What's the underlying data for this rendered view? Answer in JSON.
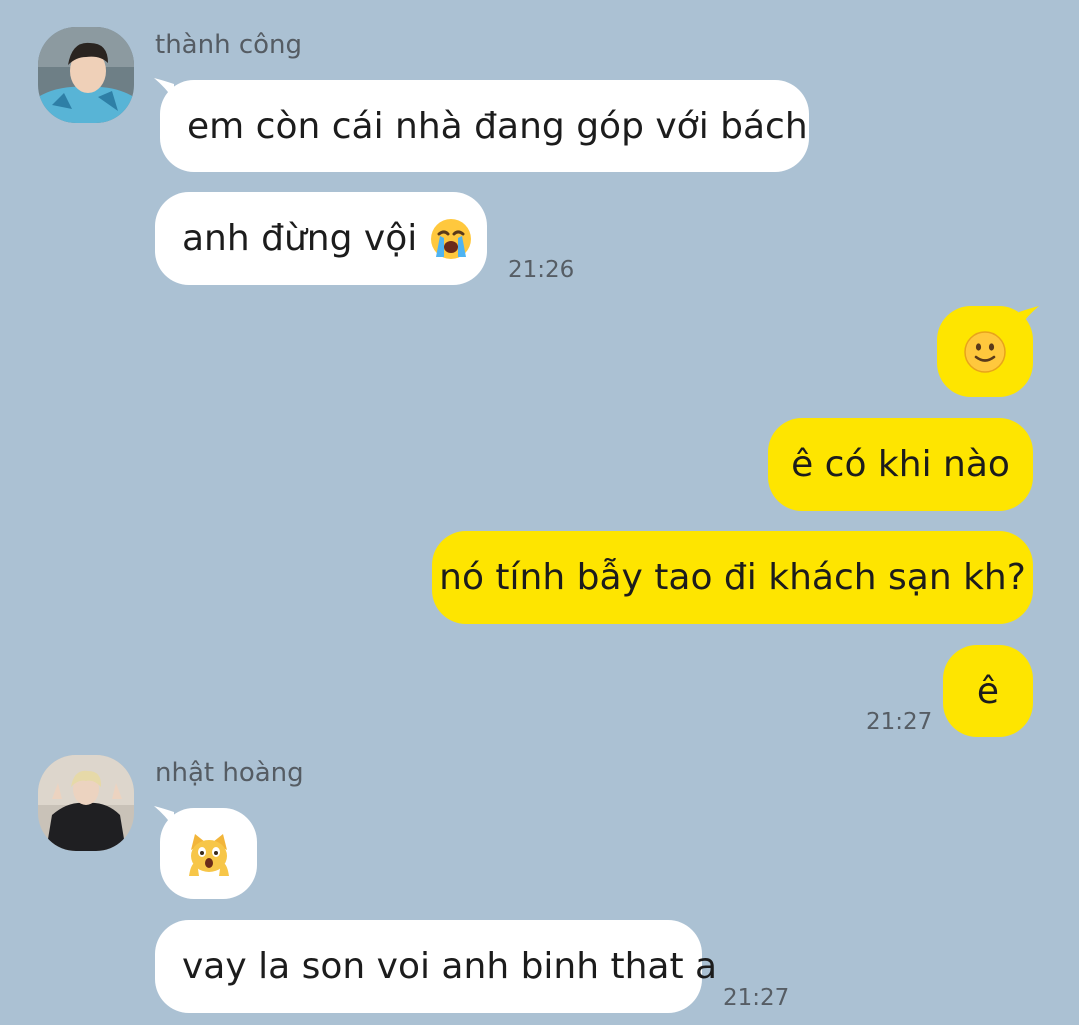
{
  "chat": {
    "groups": [
      {
        "sender": "thành công",
        "messages": [
          {
            "text": "em còn cái nhà đang góp với bách"
          },
          {
            "text": "anh đừng vội",
            "emoji": "loudly-crying-face-emoji"
          }
        ],
        "time": "21:26"
      },
      {
        "sender": "me",
        "messages": [
          {
            "emoji": "slightly-smiling-face-emoji"
          },
          {
            "text": "ê có khi nào"
          },
          {
            "text": "nó tính bẫy tao đi khách sạn kh?"
          },
          {
            "text": "ê"
          }
        ],
        "time": "21:27"
      },
      {
        "sender": "nhật hoàng",
        "messages": [
          {
            "emoji": "weary-cat-face-emoji"
          },
          {
            "text": "vay la son voi anh binh that a"
          }
        ],
        "time": "21:27"
      }
    ]
  },
  "colors": {
    "background": "#abc1d3",
    "incoming_bubble": "#ffffff",
    "outgoing_bubble": "#fee500"
  }
}
